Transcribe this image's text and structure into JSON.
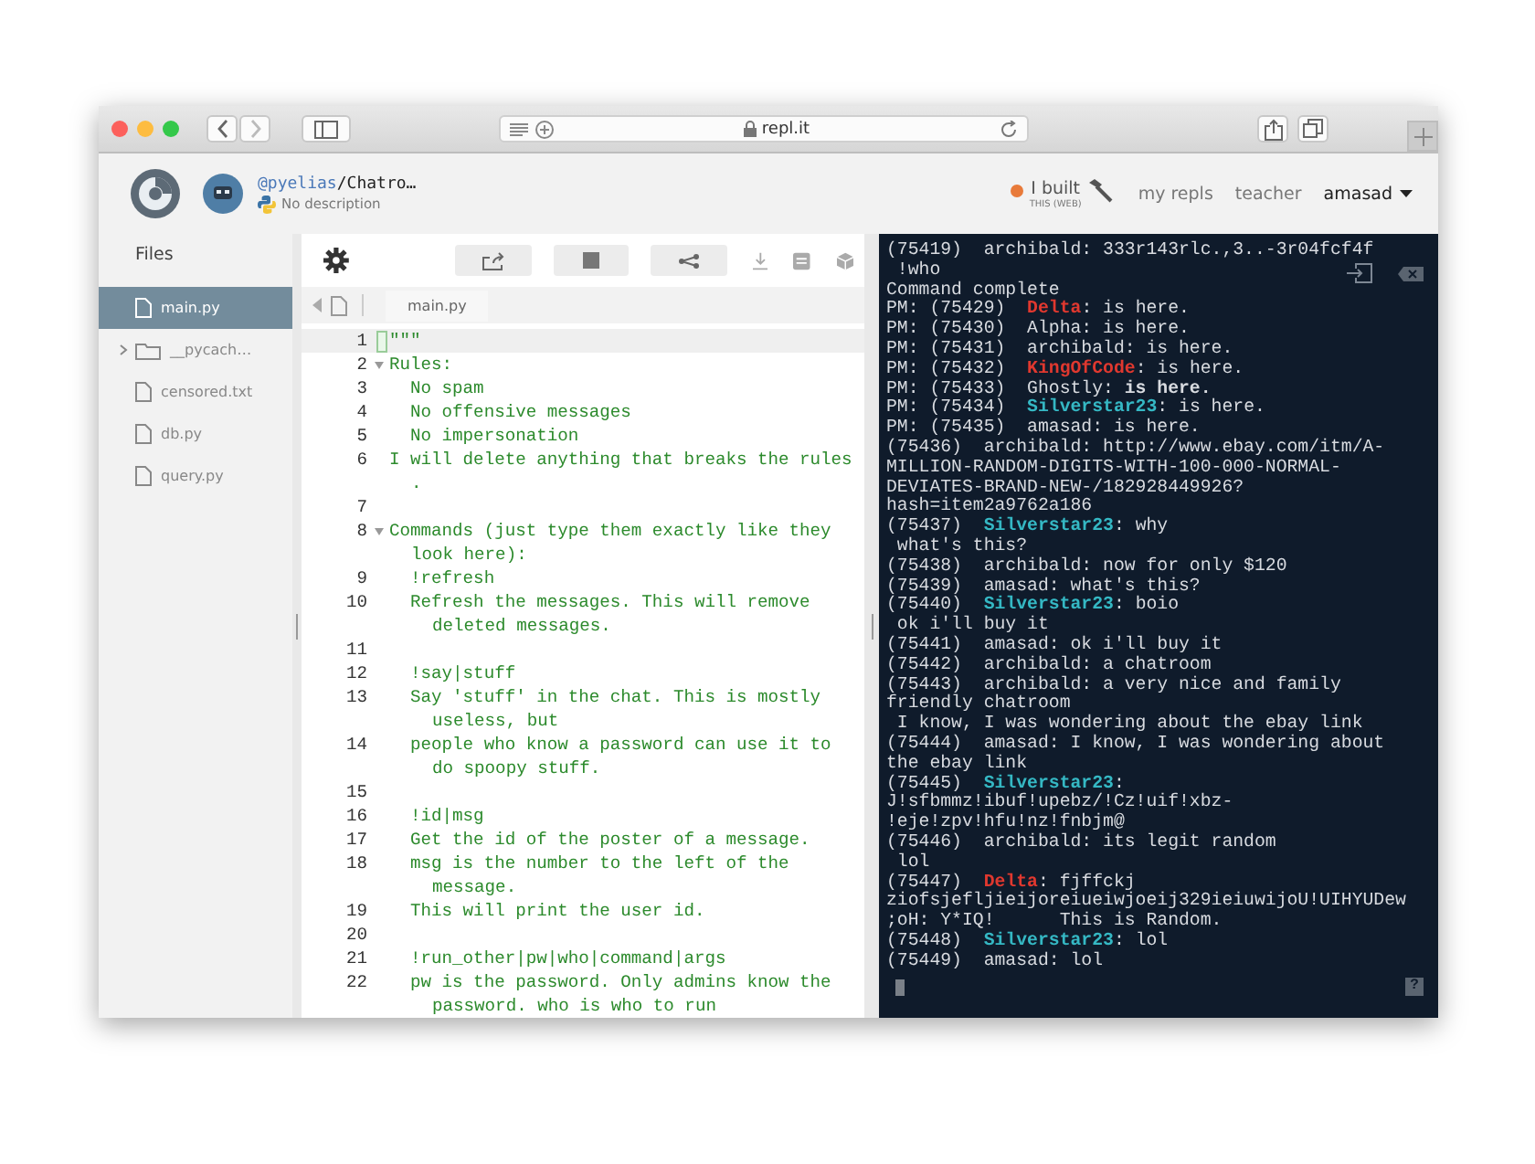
{
  "browser": {
    "address": "repl.it"
  },
  "header": {
    "owner": "@pyelias",
    "repl_name": "/Chatro…",
    "description": "No description",
    "built_label": "I built",
    "built_sub": "THIS (WEB)",
    "nav": [
      "my repls",
      "teacher"
    ],
    "user": "amasad"
  },
  "files": {
    "title": "Files",
    "items": [
      {
        "name": "main.py",
        "kind": "file",
        "selected": true
      },
      {
        "name": "__pycach…",
        "kind": "folder",
        "selected": false
      },
      {
        "name": "censored.txt",
        "kind": "file",
        "selected": false
      },
      {
        "name": "db.py",
        "kind": "file",
        "selected": false
      },
      {
        "name": "query.py",
        "kind": "file",
        "selected": false
      }
    ]
  },
  "editor": {
    "tab": "main.py",
    "lines": [
      {
        "number": "1",
        "text": "\"\"\"",
        "active": true,
        "foldable": false
      },
      {
        "number": "2",
        "text": "Rules:",
        "active": false,
        "foldable": true
      },
      {
        "number": "3",
        "text": "  No spam",
        "active": false,
        "foldable": false
      },
      {
        "number": "4",
        "text": "  No offensive messages",
        "active": false,
        "foldable": false
      },
      {
        "number": "5",
        "text": "  No impersonation",
        "active": false,
        "foldable": false
      },
      {
        "number": "6",
        "text": "I will delete anything that breaks the rules",
        "cont": ".",
        "active": false,
        "foldable": false
      },
      {
        "number": "7",
        "active": false,
        "foldable": false
      },
      {
        "number": "8",
        "text": "Commands (just type them exactly like they",
        "cont": "look here):",
        "active": false,
        "foldable": true
      },
      {
        "number": "9",
        "text": "  !refresh",
        "active": false,
        "foldable": false
      },
      {
        "number": "10",
        "text": "  Refresh the messages. This will remove",
        "cont": "  deleted messages.",
        "active": false,
        "foldable": false
      },
      {
        "number": "11",
        "active": false,
        "foldable": false
      },
      {
        "number": "12",
        "text": "  !say|stuff",
        "active": false,
        "foldable": false
      },
      {
        "number": "13",
        "text": "  Say 'stuff' in the chat. This is mostly",
        "cont": "  useless, but",
        "active": false,
        "foldable": false
      },
      {
        "number": "14",
        "text": "  people who know a password can use it to",
        "cont": "  do spoopy stuff.",
        "active": false,
        "foldable": false
      },
      {
        "number": "15",
        "active": false,
        "foldable": false
      },
      {
        "number": "16",
        "text": "  !id|msg",
        "active": false,
        "foldable": false
      },
      {
        "number": "17",
        "text": "  Get the id of the poster of a message.",
        "active": false,
        "foldable": false
      },
      {
        "number": "18",
        "text": "  msg is the number to the left of the",
        "cont": "  message.",
        "active": false,
        "foldable": false
      },
      {
        "number": "19",
        "text": "  This will print the user id.",
        "active": false,
        "foldable": false
      },
      {
        "number": "20",
        "active": false,
        "foldable": false
      },
      {
        "number": "21",
        "text": "  !run_other|pw|who|command|args",
        "active": false,
        "foldable": false
      },
      {
        "number": "22",
        "text": "  pw is the password. Only admins know the",
        "cont": "  password. who is who to run",
        "active": false,
        "foldable": false
      }
    ]
  },
  "console": {
    "lines": [
      [
        {
          "text": "(75419)  archibald: 333r143rlc.,3..-3r04fcf4f"
        }
      ],
      [
        {
          "text": " !who"
        }
      ],
      [
        {
          "text": "Command complete"
        }
      ],
      [
        {
          "text": "PM: (75429)  "
        },
        {
          "text": "Delta",
          "color": "#e0382f"
        },
        {
          "text": ": is here."
        }
      ],
      [
        {
          "text": "PM: (75430)  Alpha: is here."
        }
      ],
      [
        {
          "text": "PM: (75431)  archibald: is here."
        }
      ],
      [
        {
          "text": "PM: (75432)  "
        },
        {
          "text": "KingOfCode",
          "color": "#e0382f"
        },
        {
          "text": ": is here."
        }
      ],
      [
        {
          "text": "PM: (75433)  Ghostly: **is here.**"
        }
      ],
      [
        {
          "text": "PM: (75434)  "
        },
        {
          "text": "Silverstar23",
          "color": "#35b8c4"
        },
        {
          "text": ": is here."
        }
      ],
      [
        {
          "text": "PM: (75435)  amasad: is here."
        }
      ],
      [
        {
          "text": "(75436)  archibald: http://www.ebay.com/itm/A-"
        }
      ],
      [
        {
          "text": "MILLION-RANDOM-DIGITS-WITH-100-000-NORMAL-"
        }
      ],
      [
        {
          "text": "DEVIATES-BRAND-NEW-/182928449926?"
        }
      ],
      [
        {
          "text": "hash=item2a9762a186"
        }
      ],
      [
        {
          "text": "(75437)  "
        },
        {
          "text": "Silverstar23",
          "color": "#35b8c4"
        },
        {
          "text": ": why"
        }
      ],
      [
        {
          "text": " what's this?"
        }
      ],
      [
        {
          "text": "(75438)  archibald: now for only $120"
        }
      ],
      [
        {
          "text": "(75439)  amasad: what's this?"
        }
      ],
      [
        {
          "text": "(75440)  "
        },
        {
          "text": "Silverstar23",
          "color": "#35b8c4"
        },
        {
          "text": ": boio"
        }
      ],
      [
        {
          "text": " ok i'll buy it"
        }
      ],
      [
        {
          "text": "(75441)  amasad: ok i'll buy it"
        }
      ],
      [
        {
          "text": "(75442)  archibald: a chatroom"
        }
      ],
      [
        {
          "text": "(75443)  archibald: a very nice and family"
        }
      ],
      [
        {
          "text": "friendly chatroom"
        }
      ],
      [
        {
          "text": " I know, I was wondering about the ebay link"
        }
      ],
      [
        {
          "text": "(75444)  amasad: I know, I was wondering about"
        }
      ],
      [
        {
          "text": "the ebay link"
        }
      ],
      [
        {
          "text": "(75445)  "
        },
        {
          "text": "Silverstar23",
          "color": "#35b8c4"
        },
        {
          "text": ":"
        }
      ],
      [
        {
          "text": "J!sfbmmz!ibuf!upebz/!Cz!uif!xbz-"
        }
      ],
      [
        {
          "text": "!eje!zpv!hfu!nz!fnbjm@"
        }
      ],
      [
        {
          "text": "(75446)  archibald: its legit random"
        }
      ],
      [
        {
          "text": " lol"
        }
      ],
      [
        {
          "text": "(75447)  "
        },
        {
          "text": "Delta",
          "color": "#e0382f"
        },
        {
          "text": ": fjffckj"
        }
      ],
      [
        {
          "text": "ziofsjefljieijoreiueiwjoeij329ieiuwijoU!UIHYUDew"
        }
      ],
      [
        {
          "text": ";oH: Y*IQ!      This is Random."
        }
      ],
      [
        {
          "text": "(75448)  "
        },
        {
          "text": "Silverstar23",
          "color": "#35b8c4"
        },
        {
          "text": ": lol"
        }
      ],
      [
        {
          "text": "(75449)  amasad: lol"
        }
      ]
    ],
    "help": "?"
  }
}
